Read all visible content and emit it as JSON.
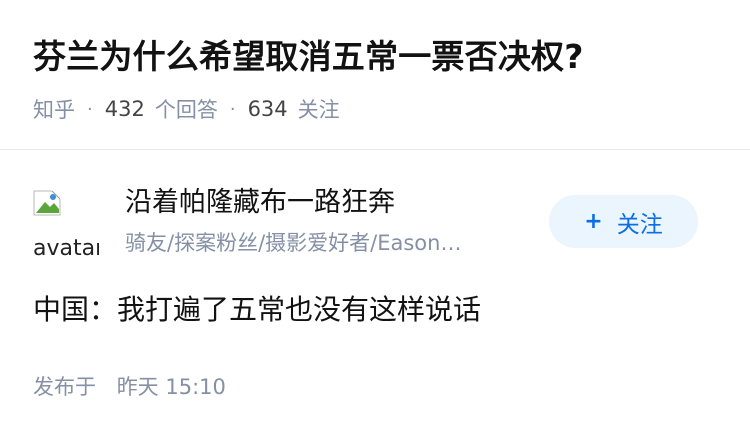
{
  "question": {
    "title": "芬兰为什么希望取消五常一票否决权?",
    "source": "知乎",
    "answer_count": "432",
    "answer_label": "个回答",
    "follower_count": "634",
    "follower_label": "关注"
  },
  "author": {
    "avatar_alt": "avatar",
    "name": "沿着帕隆藏布一路狂奔",
    "bio": "骑友/探案粉丝/摄影爱好者/Eason…"
  },
  "follow_button": {
    "plus": "+",
    "label": "关注"
  },
  "answer": {
    "content": "中国：我打遍了五常也没有这样说话",
    "published_label": "发布于",
    "published_time": "昨天 15:10"
  },
  "colors": {
    "meta_gray": "#8590a6",
    "accent_blue": "#0b6ee6",
    "follow_bg": "#ebf5fd"
  }
}
